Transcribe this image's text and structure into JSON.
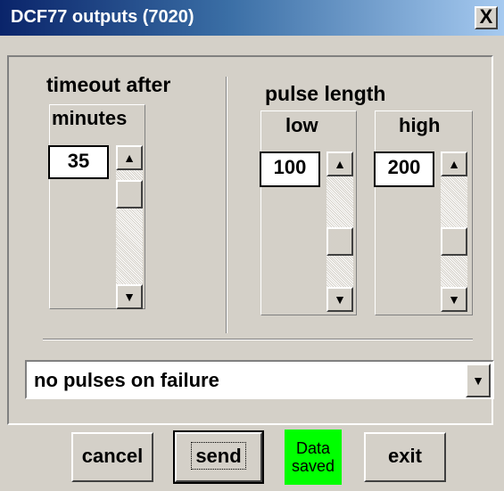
{
  "window": {
    "title": "DCF77 outputs (7020)",
    "close_label": "X"
  },
  "timeout": {
    "label_line1": "timeout after",
    "label_line2": "minutes",
    "value": "35",
    "level": 0.2
  },
  "pulse": {
    "label": "pulse length",
    "low": {
      "label": "low",
      "value": "100",
      "level": 0.5
    },
    "high": {
      "label": "high",
      "value": "200",
      "level": 0.5
    }
  },
  "failure_select": {
    "value": "no pulses on failure"
  },
  "buttons": {
    "cancel": "cancel",
    "send": "send",
    "exit": "exit"
  },
  "status": {
    "line1": "Data",
    "line2": "saved",
    "color": "#00ff00"
  },
  "icons": {
    "up": "scroll-up-arrow-icon",
    "down": "scroll-down-arrow-icon",
    "dropdown": "dropdown-arrow-icon"
  }
}
